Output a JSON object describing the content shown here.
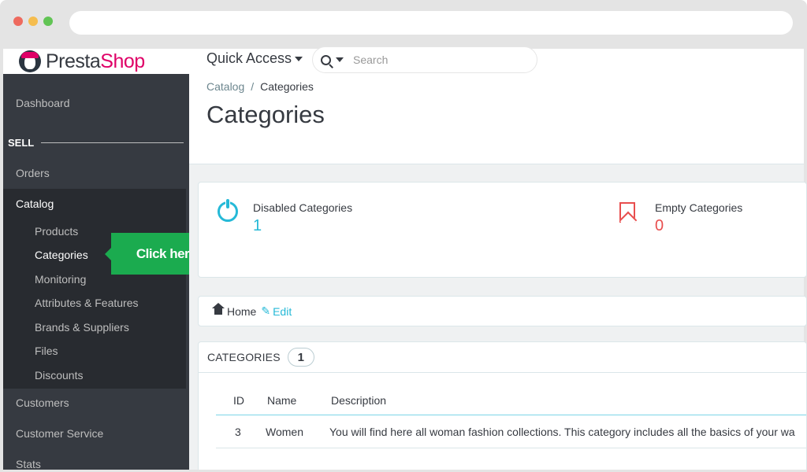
{
  "header": {
    "logo_text": "PrestaShop",
    "quick_access": "Quick Access",
    "search_placeholder": "Search"
  },
  "sidebar": {
    "dashboard": "Dashboard",
    "section_sell": "SELL",
    "orders": "Orders",
    "catalog": "Catalog",
    "catalog_items": [
      "Products",
      "Categories",
      "Monitoring",
      "Attributes & Features",
      "Brands & Suppliers",
      "Files",
      "Discounts"
    ],
    "customers": "Customers",
    "customer_service": "Customer Service",
    "stats": "Stats"
  },
  "callout": {
    "text": "Click here",
    "color": "#1bab4f"
  },
  "breadcrumb": {
    "parent": "Catalog",
    "separator": "/",
    "current": "Categories"
  },
  "page_title": "Categories",
  "kpis": [
    {
      "label": "Disabled Categories",
      "value": "1",
      "color": "#25b9d7",
      "icon": "power-icon"
    },
    {
      "label": "Empty Categories",
      "value": "0",
      "color": "#e84e4e",
      "icon": "bookmark-icon"
    }
  ],
  "tree": {
    "home": "Home",
    "edit": "Edit"
  },
  "table": {
    "title": "CATEGORIES",
    "count": "1",
    "columns": [
      "ID",
      "Name",
      "Description"
    ],
    "rows": [
      {
        "id": "3",
        "name": "Women",
        "description": "You will find here all woman fashion collections. This category includes all the basics of your wa"
      }
    ]
  }
}
